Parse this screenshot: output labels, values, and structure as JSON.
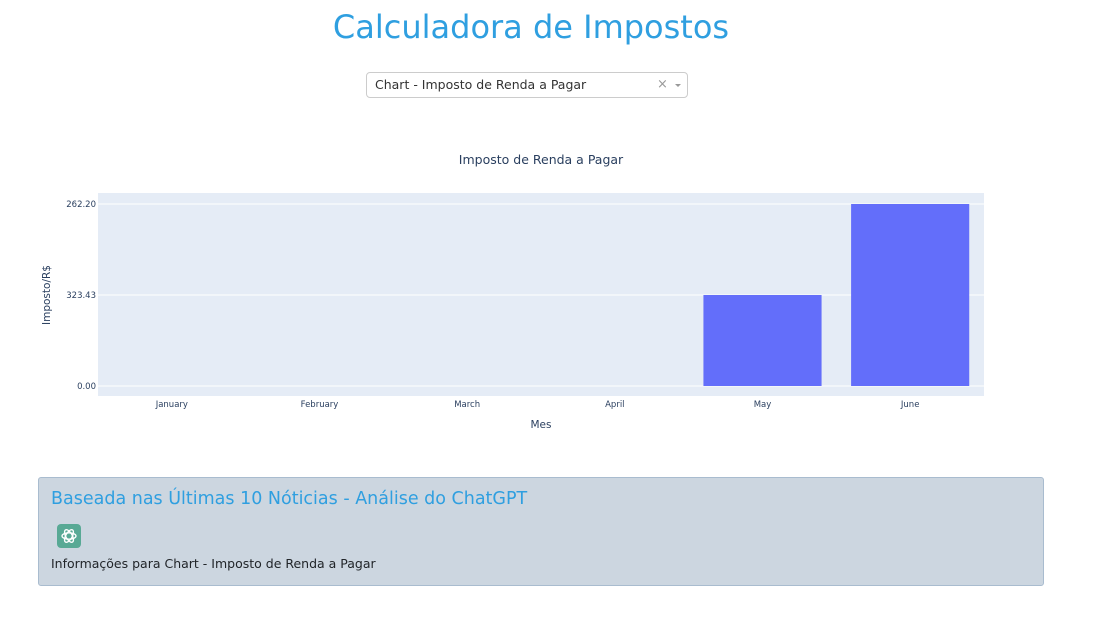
{
  "header": {
    "title": "Calculadora de Impostos"
  },
  "dropdown": {
    "selected": "Chart - Imposto de Renda a Pagar",
    "clear_symbol": "×"
  },
  "chart_data": {
    "type": "bar",
    "title": "Imposto de Renda a Pagar",
    "xlabel": "Mes",
    "ylabel": "Imposto/R$",
    "categories": [
      "January",
      "February",
      "March",
      "April",
      "May",
      "June"
    ],
    "values": [
      0,
      0,
      0,
      0,
      323.43,
      262.2
    ],
    "ytick_labels": [
      "0.00",
      "323.43",
      "262.20"
    ],
    "bar_color": "#636efa",
    "plot_bg": "#e5ecf6",
    "grid": true
  },
  "info_panel": {
    "title": "Baseada nas Últimas 10 Nóticias - Análise do ChatGPT",
    "icon": "chatgpt-icon",
    "text": "Informações para Chart - Imposto de Renda a Pagar"
  }
}
